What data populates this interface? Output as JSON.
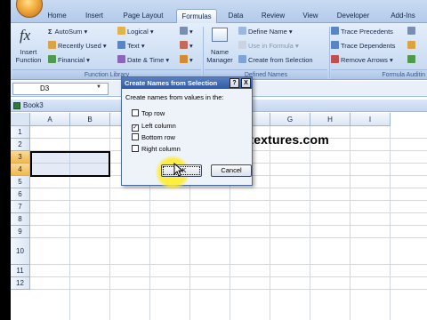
{
  "tabs": [
    "Home",
    "Insert",
    "Page Layout",
    "Formulas",
    "Data",
    "Review",
    "View",
    "Developer",
    "Add-Ins"
  ],
  "active_tab": "Formulas",
  "ribbon": {
    "insert_function": {
      "symbol": "fx",
      "label1": "Insert",
      "label2": "Function"
    },
    "function_library": {
      "autosum": "AutoSum",
      "recently_used": "Recently Used",
      "financial": "Financial",
      "logical": "Logical",
      "text": "Text",
      "date_time": "Date & Time",
      "label": "Function Library"
    },
    "defined_names": {
      "name_manager1": "Name",
      "name_manager2": "Manager",
      "define_name": "Define Name",
      "use_in_formula": "Use in Formula",
      "create_from_selection": "Create from Selection",
      "label": "Defined Names"
    },
    "formula_auditing": {
      "trace_precedents": "Trace Precedents",
      "trace_dependents": "Trace Dependents",
      "remove_arrows": "Remove Arrows",
      "label": "Formula Auditin"
    }
  },
  "namebox": "D3",
  "workbook_title": "Book3",
  "columns": [
    "A",
    "B",
    "C",
    "D",
    "E",
    "F",
    "G",
    "H",
    "I"
  ],
  "rows": [
    "1",
    "2",
    "3",
    "4",
    "5",
    "6",
    "7",
    "8",
    "9",
    "10",
    "11",
    "12"
  ],
  "selected_rows": [
    "3",
    "4"
  ],
  "watermark": "www.contextures.com",
  "dialog": {
    "title": "Create Names from Selection",
    "help": "?",
    "close": "X",
    "prompt": "Create names from values in the:",
    "options": [
      {
        "label": "Top row",
        "checked": false
      },
      {
        "label": "Left column",
        "checked": true
      },
      {
        "label": "Bottom row",
        "checked": false
      },
      {
        "label": "Right column",
        "checked": false
      }
    ],
    "ok": "OK",
    "cancel": "Cancel"
  },
  "colors": {
    "accent": "#2f5aa6",
    "selection_header": "#f1b84f",
    "cursor_highlight": "#fff028"
  }
}
